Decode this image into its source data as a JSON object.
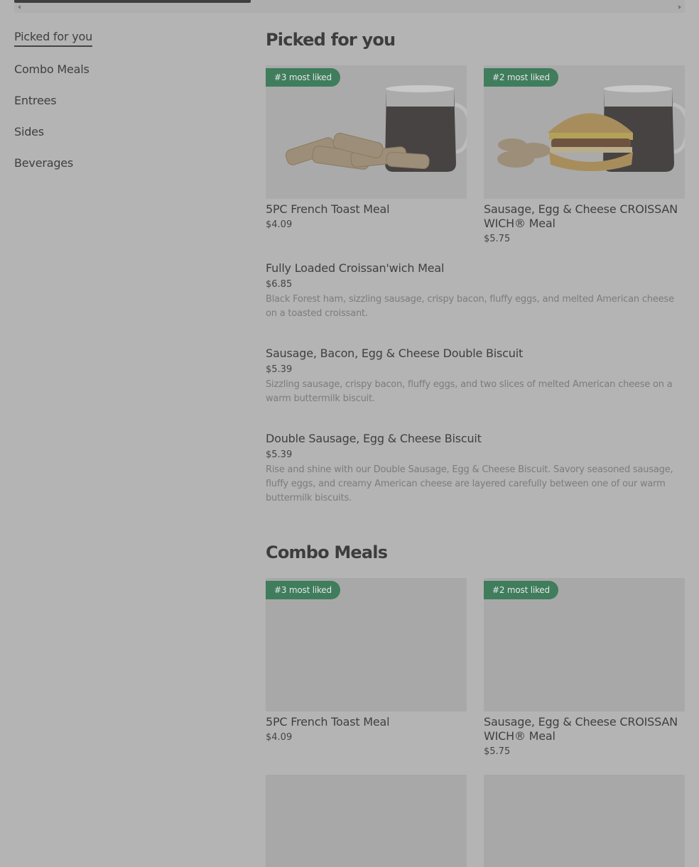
{
  "sidebar": {
    "items": [
      {
        "label": "Picked for you"
      },
      {
        "label": "Combo Meals"
      },
      {
        "label": "Entrees"
      },
      {
        "label": "Sides"
      },
      {
        "label": "Beverages"
      }
    ]
  },
  "sections": {
    "picked": {
      "title": "Picked for you",
      "cards": [
        {
          "badge": "#3 most liked",
          "name": "5PC French Toast Meal",
          "price": "$4.09"
        },
        {
          "badge": "#2 most liked",
          "name": "Sausage, Egg & Cheese CROISSAN WICH® Meal",
          "price": "$5.75"
        }
      ],
      "items": [
        {
          "name": "Fully Loaded Croissan'wich Meal",
          "price": "$6.85",
          "desc": "Black Forest ham, sizzling sausage, crispy bacon, fluffy eggs, and melted American cheese on a toasted croissant."
        },
        {
          "name": "Sausage, Bacon, Egg & Cheese Double Biscuit",
          "price": "$5.39",
          "desc": "Sizzling sausage, crispy bacon, fluffy eggs, and two slices of melted American cheese on a warm buttermilk biscuit."
        },
        {
          "name": "Double Sausage, Egg & Cheese Biscuit",
          "price": "$5.39",
          "desc": "Rise and shine with our Double Sausage, Egg & Cheese Biscuit. Savory seasoned sausage, fluffy eggs, and creamy American cheese are layered carefully between one of our warm buttermilk biscuits."
        }
      ]
    },
    "combo": {
      "title": "Combo Meals",
      "cards": [
        {
          "badge": "#3 most liked",
          "name": "5PC French Toast Meal",
          "price": "$4.09"
        },
        {
          "badge": "#2 most liked",
          "name": "Sausage, Egg & Cheese CROISSAN WICH® Meal",
          "price": "$5.75"
        }
      ]
    }
  },
  "colors": {
    "overlay_bg": "#b4b4b4",
    "badge": "#3f7d5c"
  }
}
